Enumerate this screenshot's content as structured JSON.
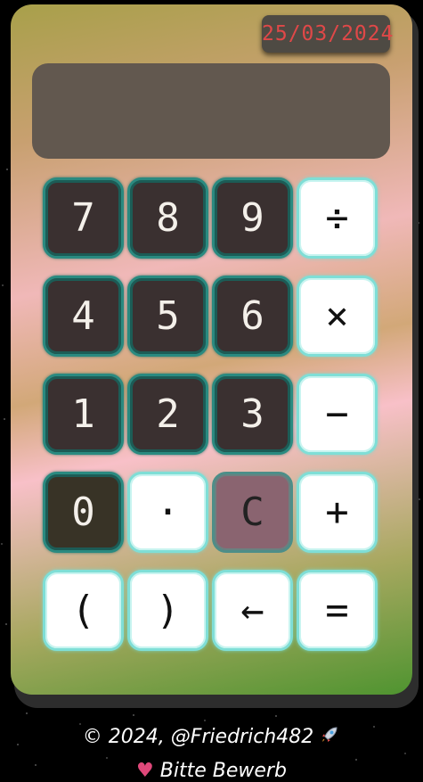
{
  "date": "25/03/2024",
  "display": {
    "value": ""
  },
  "keys": [
    {
      "label": "7",
      "name": "key-7",
      "style": "dark"
    },
    {
      "label": "8",
      "name": "key-8",
      "style": "dark"
    },
    {
      "label": "9",
      "name": "key-9",
      "style": "dark"
    },
    {
      "label": "÷",
      "name": "divide-button",
      "style": "light"
    },
    {
      "label": "4",
      "name": "key-4",
      "style": "dark"
    },
    {
      "label": "5",
      "name": "key-5",
      "style": "dark"
    },
    {
      "label": "6",
      "name": "key-6",
      "style": "dark"
    },
    {
      "label": "×",
      "name": "multiply-button",
      "style": "light"
    },
    {
      "label": "1",
      "name": "key-1",
      "style": "dark"
    },
    {
      "label": "2",
      "name": "key-2",
      "style": "dark"
    },
    {
      "label": "3",
      "name": "key-3",
      "style": "dark"
    },
    {
      "label": "−",
      "name": "subtract-button",
      "style": "light"
    },
    {
      "label": "0",
      "name": "key-0",
      "style": "dark olive"
    },
    {
      "label": "·",
      "name": "decimal-point-button",
      "style": "light"
    },
    {
      "label": "C",
      "name": "clear-button",
      "style": "clear"
    },
    {
      "label": "+",
      "name": "add-button",
      "style": "light"
    },
    {
      "label": "(",
      "name": "open-paren-button",
      "style": "light"
    },
    {
      "label": ")",
      "name": "close-paren-button",
      "style": "light"
    },
    {
      "label": "←",
      "name": "backspace-button",
      "style": "light"
    },
    {
      "label": "=",
      "name": "equals-button",
      "style": "light"
    }
  ],
  "footer": {
    "copyright": "© 2024, @Friedrich482",
    "rocket_icon": "rocket-icon",
    "line2": "Bitte Bewerb"
  },
  "colors": {
    "date_text": "#e04848",
    "dark_key_border": "#2a8a80",
    "light_key_border": "#7fded6"
  }
}
